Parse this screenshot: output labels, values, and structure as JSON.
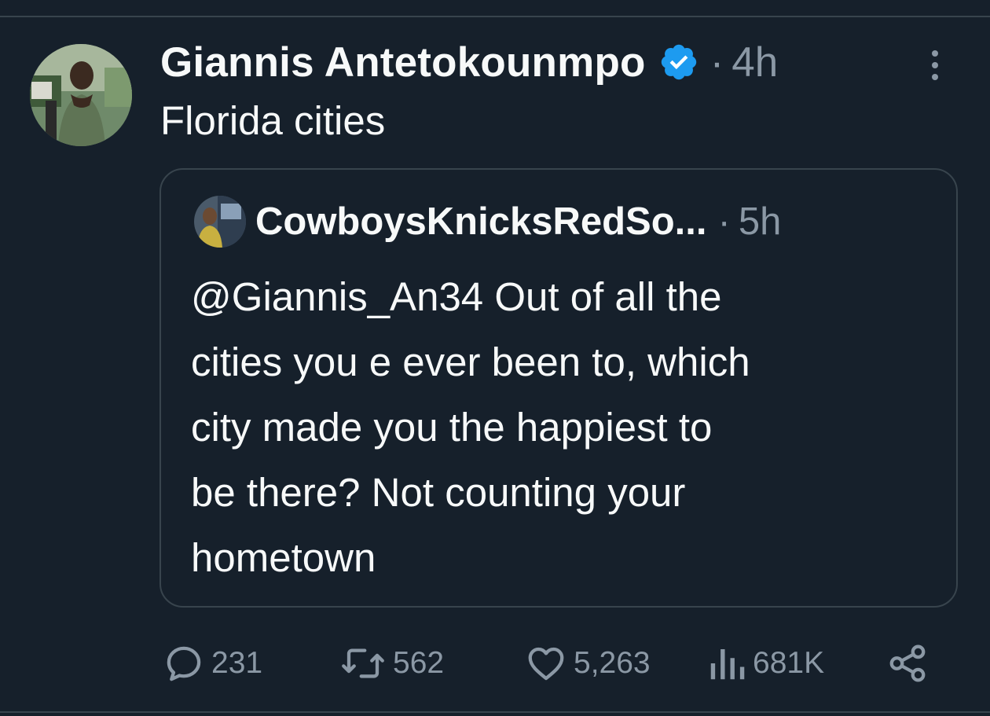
{
  "tweet": {
    "author": {
      "display_name": "Giannis Antetokounmpo",
      "verified": true
    },
    "meta_separator": "·",
    "time": "4h",
    "text": "Florida cities",
    "more_icon": "more-vertical-icon",
    "verified_icon": "verified-badge-icon"
  },
  "quote": {
    "author": {
      "display_name": "CowboysKnicksRedSo..."
    },
    "meta_separator": "·",
    "time": "5h",
    "lines": [
      "@Giannis_An34 Out of all the",
      "cities you e ever been to, which",
      "city made you the happiest to",
      "be there? Not counting your",
      "hometown"
    ]
  },
  "actions": {
    "reply": {
      "icon": "reply-icon",
      "count": "231"
    },
    "retweet": {
      "icon": "retweet-icon",
      "count": "562"
    },
    "like": {
      "icon": "heart-icon",
      "count": "5,263"
    },
    "views": {
      "icon": "views-icon",
      "count": "681K"
    },
    "share": {
      "icon": "share-icon"
    }
  },
  "colors": {
    "background": "#16202b",
    "text_primary": "#f7f9f9",
    "text_secondary": "#8b98a5",
    "border": "#38444d",
    "verified_blue": "#1d9bf0"
  }
}
